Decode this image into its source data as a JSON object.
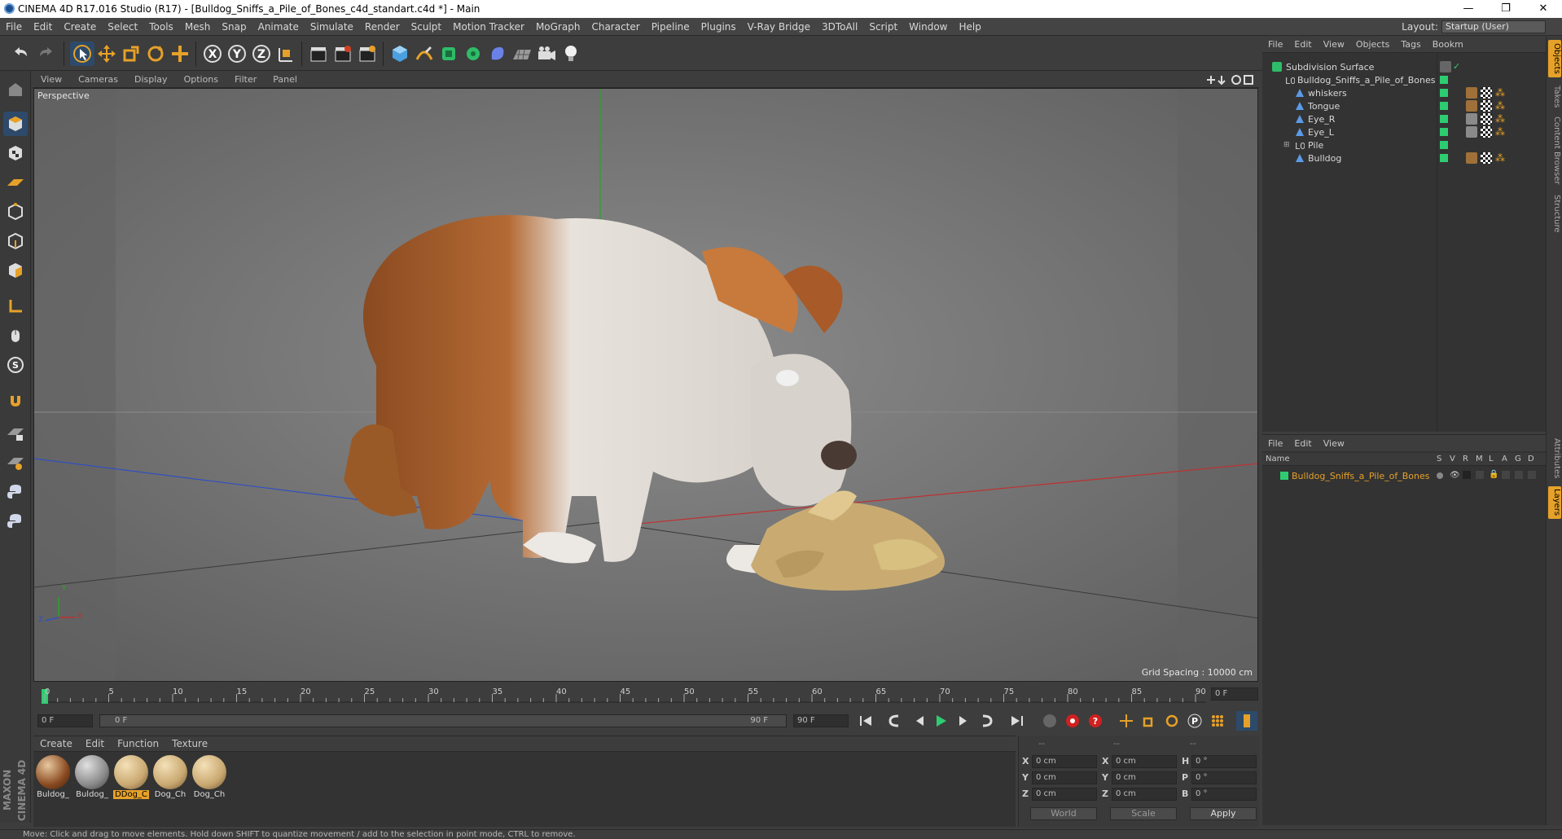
{
  "window": {
    "title": "CINEMA 4D R17.016 Studio (R17) - [Bulldog_Sniffs_a_Pile_of_Bones_c4d_standart.c4d *] - Main",
    "minimize": "—",
    "restore": "❐",
    "close": "✕"
  },
  "menu": [
    "File",
    "Edit",
    "Create",
    "Select",
    "Tools",
    "Mesh",
    "Snap",
    "Animate",
    "Simulate",
    "Render",
    "Sculpt",
    "Motion Tracker",
    "MoGraph",
    "Character",
    "Pipeline",
    "Plugins",
    "V-Ray Bridge",
    "3DToAll",
    "Script",
    "Window",
    "Help"
  ],
  "layout": {
    "label": "Layout:",
    "value": "Startup (User)"
  },
  "viewport": {
    "menu": [
      "View",
      "Cameras",
      "Display",
      "Options",
      "Filter",
      "Panel"
    ],
    "label": "Perspective",
    "grid_spacing": "Grid Spacing : 10000 cm",
    "axis_x": "X",
    "axis_y": "Y",
    "axis_z": "Z"
  },
  "timeline": {
    "ticks": [
      "0",
      "5",
      "10",
      "15",
      "20",
      "25",
      "30",
      "35",
      "40",
      "45",
      "50",
      "55",
      "60",
      "65",
      "70",
      "75",
      "80",
      "85",
      "90"
    ],
    "current_frame": "0 F",
    "start_frame": "0 F",
    "range_start": "0 F",
    "range_end": "90 F",
    "end_frame": "90 F"
  },
  "materials": {
    "menu": [
      "Create",
      "Edit",
      "Function",
      "Texture"
    ],
    "items": [
      {
        "label": "Buldog_",
        "color": "#a0703a",
        "selected": false
      },
      {
        "label": "Buldog_",
        "color": "#8a8a8a",
        "selected": false
      },
      {
        "label": "DDog_C",
        "color": "#c9a870",
        "selected": true
      },
      {
        "label": "Dog_Ch",
        "color": "#c9a870",
        "selected": false
      },
      {
        "label": "Dog_Ch",
        "color": "#c9a870",
        "selected": false
      }
    ]
  },
  "coordinates": {
    "headers": [
      "--",
      "--",
      "--"
    ],
    "pos_x": "0 cm",
    "pos_y": "0 cm",
    "pos_z": "0 cm",
    "size_x": "0 cm",
    "size_y": "0 cm",
    "size_z": "0 cm",
    "rot_h": "0 °",
    "rot_p": "0 °",
    "rot_b": "0 °",
    "lab_x": "X",
    "lab_y": "Y",
    "lab_z": "Z",
    "lab_h": "H",
    "lab_p": "P",
    "lab_b": "B",
    "mode_world": "World",
    "mode_scale": "Scale",
    "apply": "Apply"
  },
  "objects": {
    "menu": [
      "File",
      "Edit",
      "View",
      "Objects",
      "Tags",
      "Bookm"
    ],
    "items": [
      {
        "name": "Subdivision Surface"
      },
      {
        "name": "Bulldog_Sniffs_a_Pile_of_Bones"
      },
      {
        "name": "whiskers"
      },
      {
        "name": "Tongue"
      },
      {
        "name": "Eye_R"
      },
      {
        "name": "Eye_L"
      },
      {
        "name": "Pile"
      },
      {
        "name": "Bulldog"
      }
    ]
  },
  "layers": {
    "menu": [
      "File",
      "Edit",
      "View"
    ],
    "columns": {
      "name": "Name",
      "flags": [
        "S",
        "V",
        "R",
        "M",
        "L",
        "A",
        "G",
        "D"
      ]
    },
    "items": [
      {
        "name": "Bulldog_Sniffs_a_Pile_of_Bones"
      }
    ]
  },
  "side_tabs": [
    "Objects",
    "Takes",
    "Content Browser",
    "Structure",
    "Attributes",
    "Layers"
  ],
  "status": "Move: Click and drag to move elements. Hold down SHIFT to quantize movement / add to the selection in point mode, CTRL to remove.",
  "colors": {
    "accent": "#e6a128",
    "layer_green": "#2ecc71",
    "axis_red": "#c03030",
    "axis_green": "#2ea02e",
    "axis_blue": "#3050c0"
  }
}
